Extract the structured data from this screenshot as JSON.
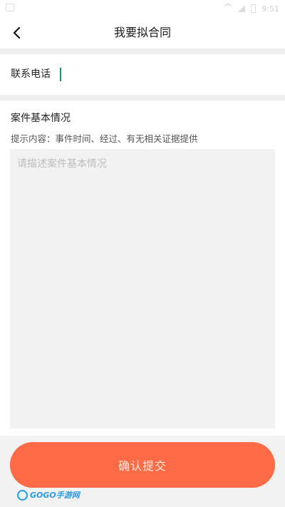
{
  "status_bar": {
    "time": "9:51"
  },
  "header": {
    "title": "我要拟合同",
    "back_icon": "chevron-left-icon"
  },
  "phone": {
    "label": "联系电话",
    "value": "",
    "placeholder": ""
  },
  "case": {
    "title": "案件基本情况",
    "hint": "提示内容：事件时间、经过、有无相关证据提供",
    "placeholder": "请描述案件基本情况",
    "value": ""
  },
  "actions": {
    "submit_label": "确认提交"
  },
  "colors": {
    "accent": "#ff6b46",
    "cursor": "#1f8a7e",
    "background": "#f2f2f2"
  }
}
